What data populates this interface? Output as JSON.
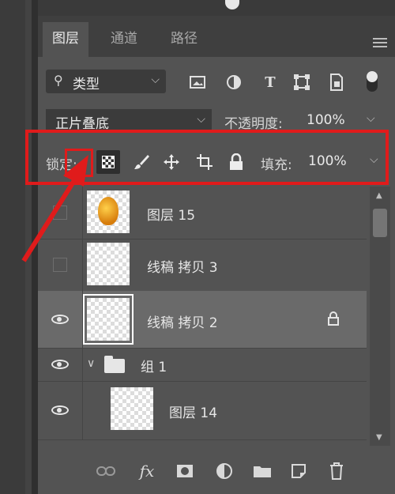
{
  "tabs": [
    {
      "label": "图层",
      "active": true
    },
    {
      "label": "通道",
      "active": false
    },
    {
      "label": "路径",
      "active": false
    }
  ],
  "filter": {
    "kind_label": "类型",
    "icons": [
      "image-filter-icon",
      "adjustment-filter-icon",
      "type-filter-icon",
      "shape-filter-icon",
      "smart-object-filter-icon"
    ]
  },
  "blend": {
    "mode": "正片叠底",
    "opacity_label": "不透明度:",
    "opacity_value": "100%"
  },
  "lock": {
    "label": "锁定:",
    "fill_label": "填充:",
    "fill_value": "100%"
  },
  "layers": [
    {
      "name": "图层 15",
      "visible": false,
      "locked": false,
      "selected": false
    },
    {
      "name": "线稿 拷贝 3",
      "visible": false,
      "locked": false,
      "selected": false
    },
    {
      "name": "线稿 拷贝 2",
      "visible": true,
      "locked": true,
      "selected": true
    },
    {
      "name": "组 1",
      "visible": true,
      "type": "group",
      "expanded": true
    },
    {
      "name": "图层 14",
      "visible": true,
      "locked": false,
      "selected": false
    }
  ],
  "bottom_icons": [
    "link-layers-icon",
    "fx-icon",
    "add-mask-icon",
    "adjustment-layer-icon",
    "new-group-icon",
    "new-layer-icon",
    "delete-icon"
  ],
  "colors": {
    "highlight": "#e01b1b",
    "panel": "#535353",
    "selected_row": "#6a6a6a"
  }
}
